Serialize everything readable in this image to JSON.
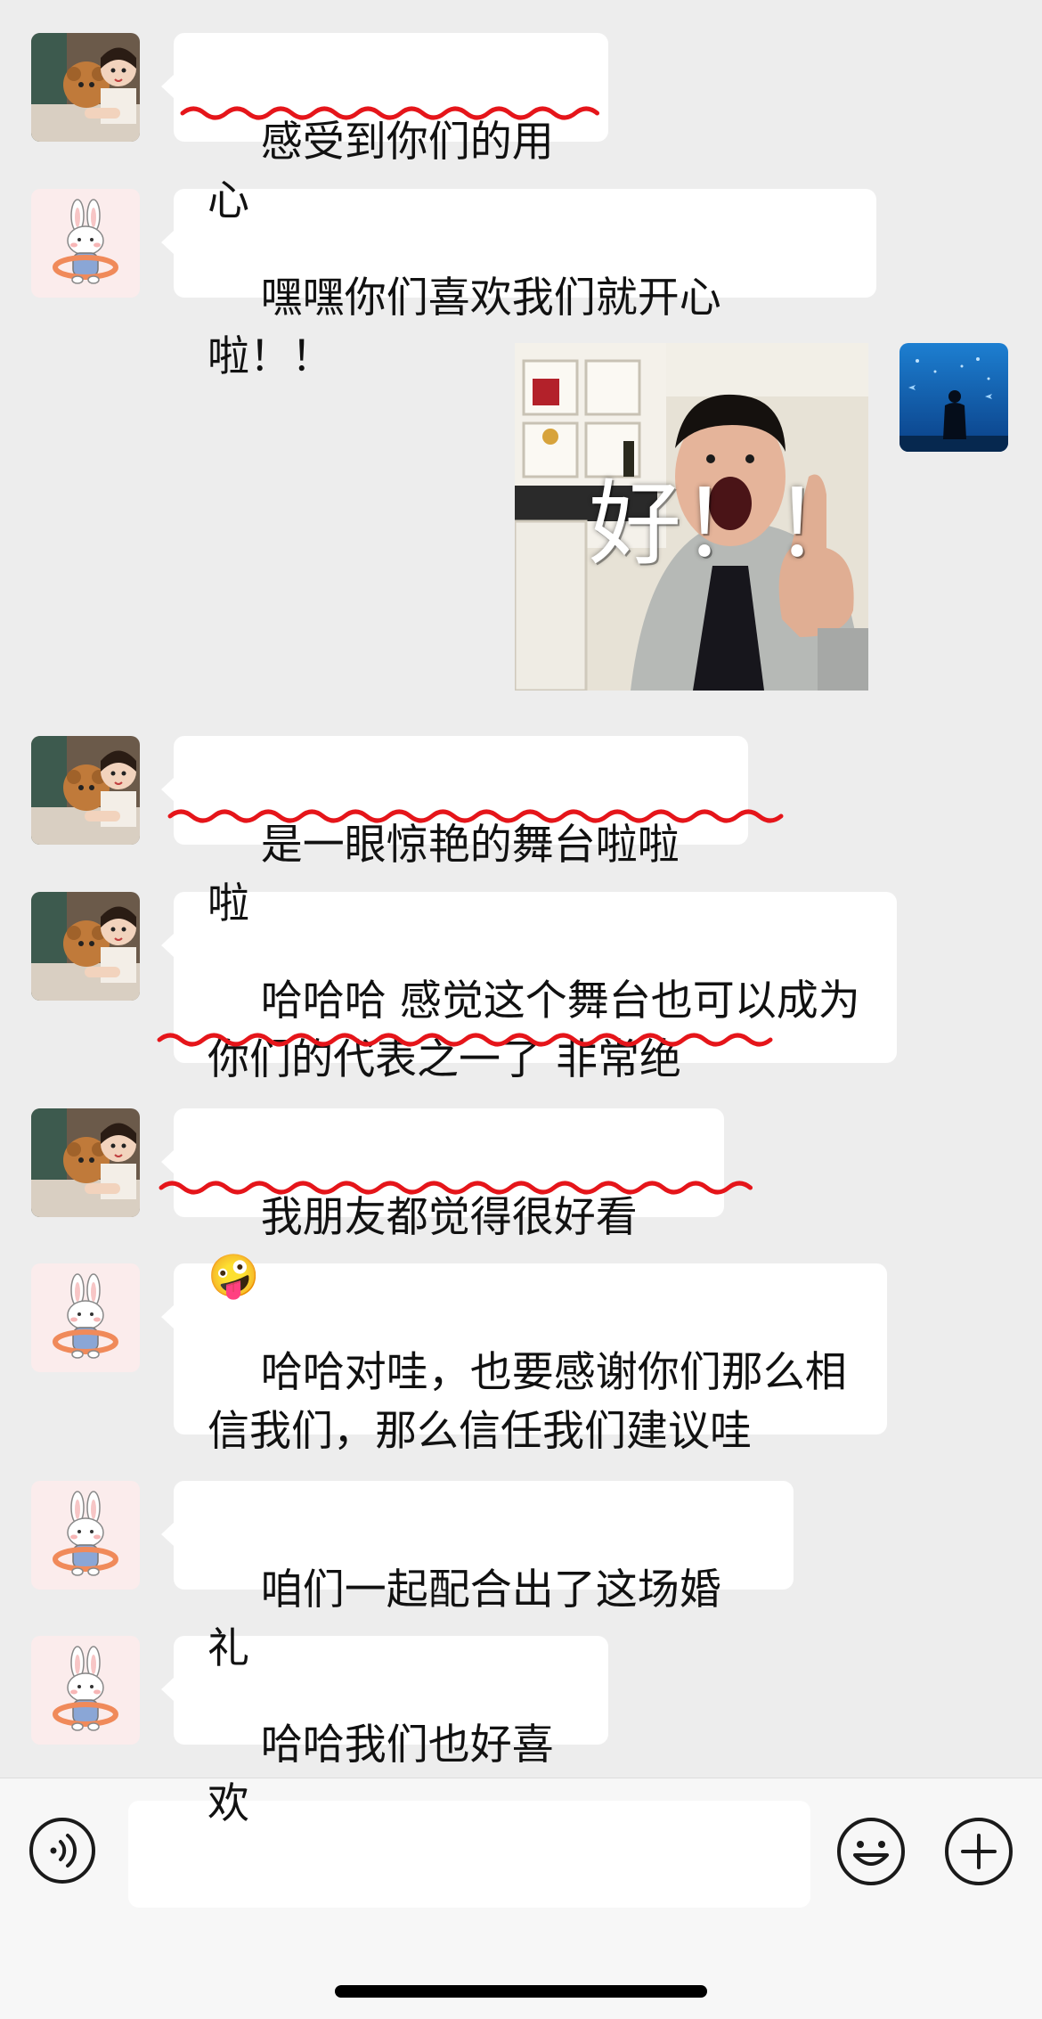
{
  "messages": [
    {
      "id": 1,
      "sender": "other",
      "avatar": "girl-with-cat",
      "text": "感受到你们的用心",
      "underlined": true
    },
    {
      "id": 2,
      "sender": "merchant",
      "avatar": "bunny",
      "text": "嘿嘿你们喜欢我们就开心啦！！",
      "underlined": false
    },
    {
      "id": 3,
      "sender": "self",
      "avatar": "aquarium-silhouette",
      "type": "sticker",
      "sticker_caption": "好！！"
    },
    {
      "id": 4,
      "sender": "other",
      "avatar": "girl-with-cat",
      "text": "是一眼惊艳的舞台啦啦啦",
      "underlined": true
    },
    {
      "id": 5,
      "sender": "other",
      "avatar": "girl-with-cat",
      "text": "哈哈哈 感觉这个舞台也可以成为\n你们的代表之一了 非常绝",
      "underlined": true
    },
    {
      "id": 6,
      "sender": "other",
      "avatar": "girl-with-cat",
      "text": "我朋友都觉得很好看 🤪",
      "underlined": true
    },
    {
      "id": 7,
      "sender": "merchant",
      "avatar": "bunny",
      "text": "哈哈对哇，也要感谢你们那么相\n信我们，那么信任我们建议哇",
      "underlined": false
    },
    {
      "id": 8,
      "sender": "merchant",
      "avatar": "bunny",
      "text": "咱们一起配合出了这场婚礼",
      "underlined": false
    },
    {
      "id": 9,
      "sender": "merchant",
      "avatar": "bunny",
      "text": "哈哈我们也好喜欢",
      "underlined": false
    }
  ],
  "input_bar": {
    "voice_icon": "voice-icon",
    "input_value": "",
    "emoji_icon": "emoji-icon",
    "plus_icon": "plus-icon"
  },
  "colors": {
    "background": "#ededed",
    "bubble": "#ffffff",
    "annotation": "#e5151a",
    "input_bar": "#f7f7f7"
  }
}
